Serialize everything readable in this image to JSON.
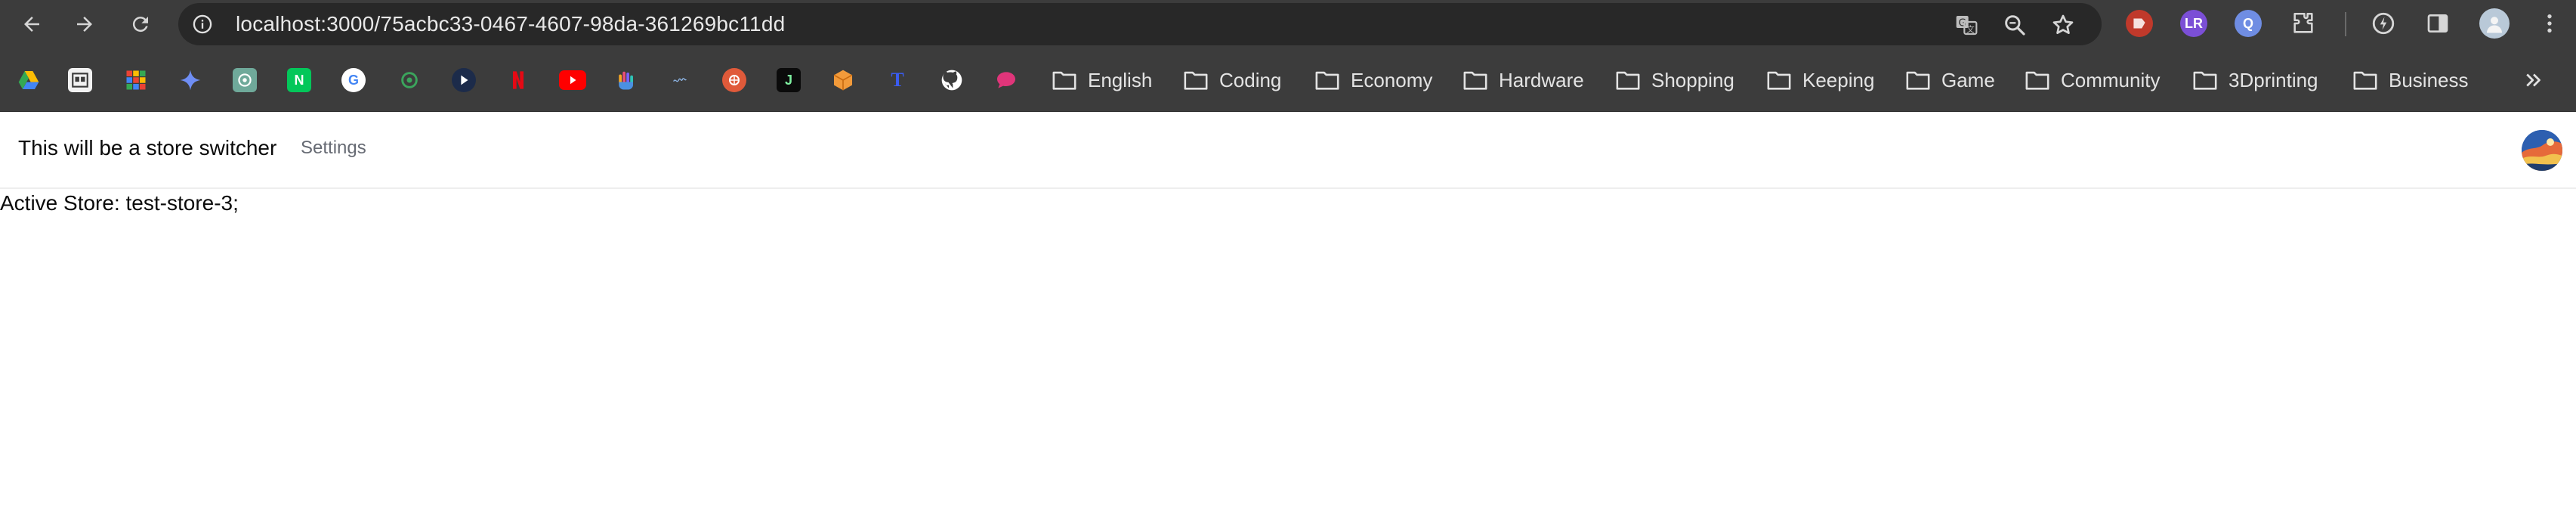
{
  "browser": {
    "url": "localhost:3000/75acbc33-0467-4607-98da-361269bc11dd",
    "icons": {
      "back": "arrow-left-icon",
      "forward": "arrow-right-icon",
      "reload": "reload-icon",
      "site_info": "info-circle-icon",
      "translate": "translate-icon",
      "zoom": "zoom-icon",
      "bookmark": "star-icon",
      "extensions": "puzzle-icon",
      "side_panel": "side-panel-icon",
      "menu": "kebab-menu-icon"
    },
    "extensions": [
      {
        "name": "red-extension-icon",
        "label": "",
        "color": "#c0392b"
      },
      {
        "name": "lr-extension-icon",
        "label": "LR",
        "color": "#7b4fd6"
      },
      {
        "name": "search-extension-icon",
        "label": "Q",
        "color": "#6f8de3"
      }
    ]
  },
  "bookmarks": {
    "sites": [
      {
        "name": "google-drive-icon",
        "label": "▲",
        "color": "#1f8f4e"
      },
      {
        "name": "roomie-icon",
        "label": "R",
        "color": "#f2f2f2"
      },
      {
        "name": "google-sheets-grid-icon",
        "label": "▦",
        "color": "#2aa34a"
      },
      {
        "name": "gemini-icon",
        "label": "✦",
        "color": "#5b7ef0"
      },
      {
        "name": "chatgpt-icon",
        "label": "✿",
        "color": "#6fa99a"
      },
      {
        "name": "naver-icon",
        "label": "N",
        "color": "#03c75a"
      },
      {
        "name": "google-icon",
        "label": "G",
        "color": "#ffffff"
      },
      {
        "name": "green-circle-icon",
        "label": "◎",
        "color": "#2f6f3a"
      },
      {
        "name": "play-icon",
        "label": "▶",
        "color": "#1c2b4a"
      },
      {
        "name": "netflix-icon",
        "label": "N",
        "color": "#000000"
      },
      {
        "name": "youtube-icon",
        "label": "▶",
        "color": "#ff0000"
      },
      {
        "name": "hand-icon",
        "label": "✋",
        "color": "#6b4fb8"
      },
      {
        "name": "mybook-icon",
        "label": "~",
        "color": "#3c3c3c"
      },
      {
        "name": "red-circle-icon",
        "label": "●",
        "color": "#e05a3a"
      },
      {
        "name": "j-icon",
        "label": "J",
        "color": "#0b0b0b"
      },
      {
        "name": "cube-icon",
        "label": "◆",
        "color": "#ef8a2a"
      },
      {
        "name": "t-icon",
        "label": "T",
        "color": "#1b3fb8"
      },
      {
        "name": "github-icon",
        "label": "●",
        "color": "#3c3c3c"
      },
      {
        "name": "chat-bubble-icon",
        "label": "●",
        "color": "#e0357a"
      }
    ],
    "folders": [
      {
        "label": "English"
      },
      {
        "label": "Coding"
      },
      {
        "label": "Economy"
      },
      {
        "label": "Hardware"
      },
      {
        "label": "Shopping"
      },
      {
        "label": "Keeping"
      },
      {
        "label": "Game"
      },
      {
        "label": "Community"
      },
      {
        "label": "3Dprinting"
      },
      {
        "label": "Business"
      }
    ],
    "folder_icon": "folder-icon",
    "more_icon": "chevron-double-right-icon"
  },
  "header": {
    "store_switcher": "This will be a store switcher",
    "settings": "Settings",
    "avatar_icon": "user-avatar-icon"
  },
  "main": {
    "active_store": "Active Store: test-store-3;"
  }
}
